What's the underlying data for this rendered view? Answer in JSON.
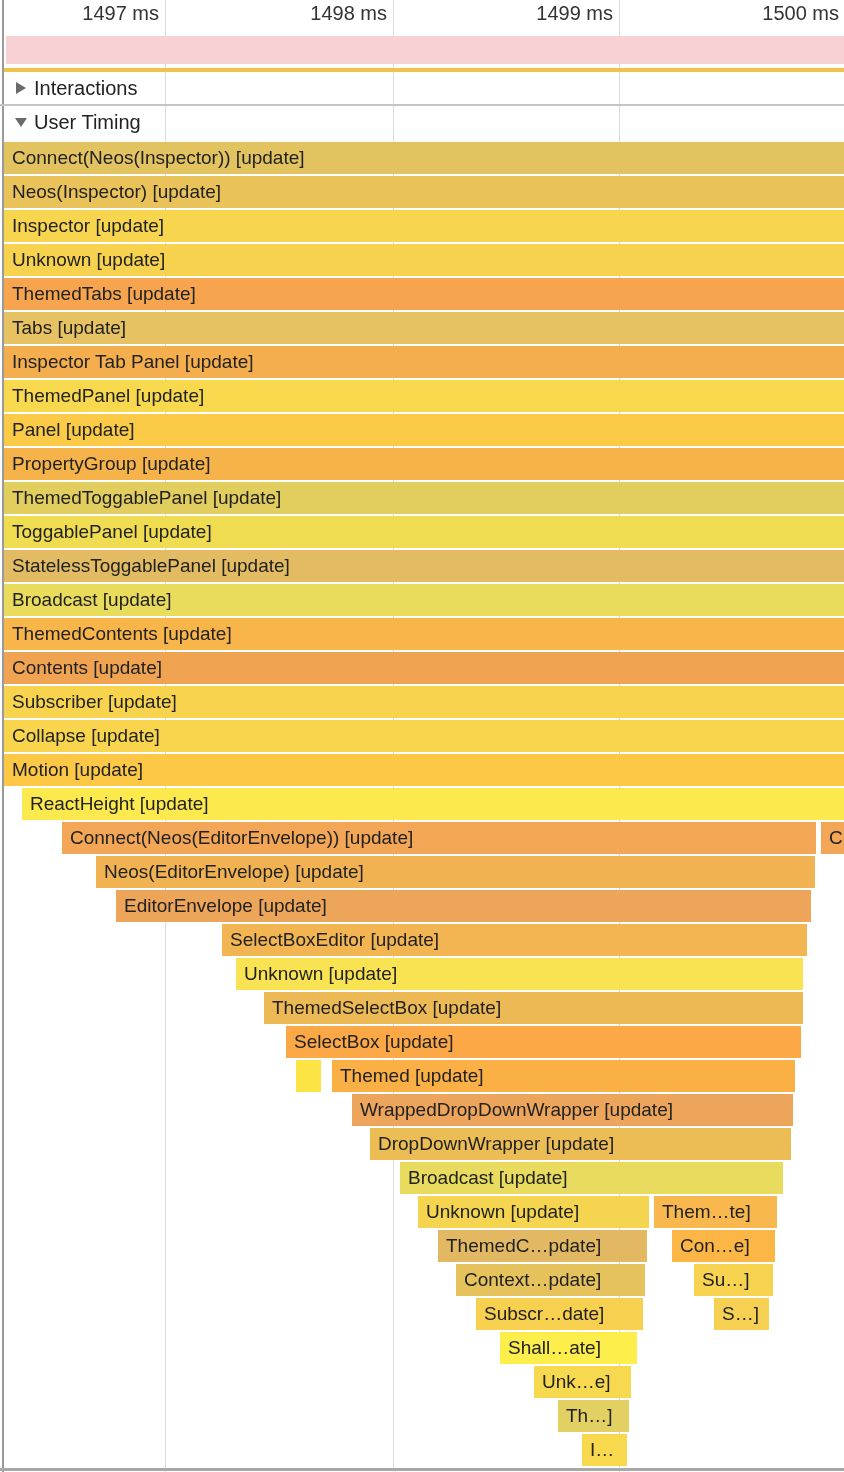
{
  "ruler": {
    "ticks": [
      {
        "label": "1497 ms"
      },
      {
        "label": "1498 ms"
      },
      {
        "label": "1499 ms"
      },
      {
        "label": "1500 ms"
      }
    ]
  },
  "tracks": [
    {
      "label": "Interactions",
      "expanded": false
    },
    {
      "label": "User Timing",
      "expanded": true
    }
  ],
  "flame_rows": [
    [
      {
        "label": "Connect(Neos(Inspector)) [update]",
        "color": "#e3c35f"
      }
    ],
    [
      {
        "label": "Neos(Inspector) [update]",
        "color": "#e9c25a"
      }
    ],
    [
      {
        "label": "Inspector [update]",
        "color": "#f8d54e"
      }
    ],
    [
      {
        "label": "Unknown [update]",
        "color": "#f6d24e"
      }
    ],
    [
      {
        "label": "ThemedTabs [update]",
        "color": "#f6a54e"
      }
    ],
    [
      {
        "label": "Tabs [update]",
        "color": "#e6c262"
      }
    ],
    [
      {
        "label": "Inspector Tab Panel [update]",
        "color": "#f5ae4d"
      }
    ],
    [
      {
        "label": "ThemedPanel [update]",
        "color": "#f8d84d"
      }
    ],
    [
      {
        "label": "Panel [update]",
        "color": "#fbcb48"
      }
    ],
    [
      {
        "label": "PropertyGroup [update]",
        "color": "#f5b34a"
      }
    ],
    [
      {
        "label": "ThemedToggablePanel [update]",
        "color": "#e2cd5f"
      }
    ],
    [
      {
        "label": "ToggablePanel [update]",
        "color": "#f0dc50"
      }
    ],
    [
      {
        "label": "StatelessToggablePanel [update]",
        "color": "#e2bb62"
      }
    ],
    [
      {
        "label": "Broadcast [update]",
        "color": "#e9dc5c"
      }
    ],
    [
      {
        "label": "ThemedContents [update]",
        "color": "#f8b54a"
      }
    ],
    [
      {
        "label": "Contents [update]",
        "color": "#f0a452"
      }
    ],
    [
      {
        "label": "Subscriber [update]",
        "color": "#f8d44e"
      }
    ],
    [
      {
        "label": "Collapse [update]",
        "color": "#f8d54c"
      }
    ],
    [
      {
        "label": "Motion [update]",
        "color": "#fcc845"
      }
    ],
    [
      {
        "label": "ReactHeight [update]",
        "color": "#fbe94d"
      }
    ],
    [
      {
        "label": "Connect(Neos(EditorEnvelope)) [update]",
        "color": "#f2a656"
      },
      {
        "label": "C",
        "color": "#f2a656"
      }
    ],
    [
      {
        "label": "Neos(EditorEnvelope) [update]",
        "color": "#f1b352"
      }
    ],
    [
      {
        "label": "EditorEnvelope [update]",
        "color": "#eda55a"
      }
    ],
    [
      {
        "label": "SelectBoxEditor [update]",
        "color": "#f2b552"
      }
    ],
    [
      {
        "label": "Unknown [update]",
        "color": "#f9e353"
      }
    ],
    [
      {
        "label": "ThemedSelectBox [update]",
        "color": "#edb955"
      }
    ],
    [
      {
        "label": "SelectBox [update]",
        "color": "#fca846"
      }
    ],
    [
      {
        "color": "#fde445"
      },
      {
        "label": "Themed [update]",
        "color": "#fbb046"
      }
    ],
    [
      {
        "label": "WrappedDropDownWrapper [update]",
        "color": "#eda55b"
      }
    ],
    [
      {
        "label": "DropDownWrapper [update]",
        "color": "#ecbd55"
      }
    ],
    [
      {
        "label": "Broadcast [update]",
        "color": "#e8db5d"
      }
    ],
    [
      {
        "label": "Unknown [update]",
        "color": "#f5d54f"
      },
      {
        "label": "Them…te]",
        "color": "#f8b84d"
      }
    ],
    [
      {
        "label": "ThemedC…pdate]",
        "color": "#e2b962"
      },
      {
        "label": "Con…e]",
        "color": "#fbb646"
      }
    ],
    [
      {
        "label": "Context…pdate]",
        "color": "#e5c25c"
      },
      {
        "label": "Su…]",
        "color": "#f7d350"
      }
    ],
    [
      {
        "label": "Subscr…date]",
        "color": "#f7d050"
      },
      {
        "label": "S…]",
        "color": "#f6d052"
      }
    ],
    [
      {
        "label": "Shall…ate]",
        "color": "#fdee4b"
      }
    ],
    [
      {
        "label": "Unk…e]",
        "color": "#f7d950"
      }
    ],
    [
      {
        "label": "Th…]",
        "color": "#e2d062"
      }
    ],
    [
      {
        "label": "I…",
        "color": "#f8d84d"
      }
    ]
  ]
}
